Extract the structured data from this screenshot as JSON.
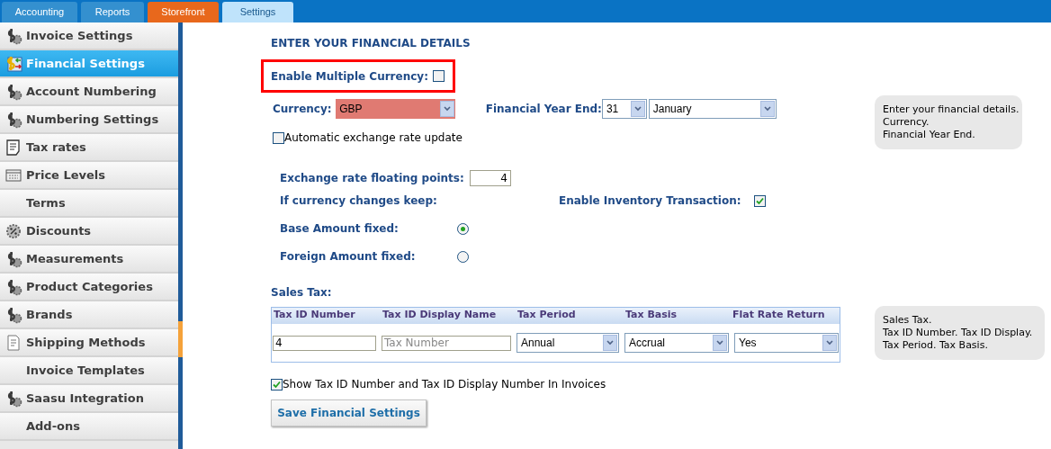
{
  "tabs": [
    {
      "label": "Accounting",
      "selected": false,
      "kind": "normal"
    },
    {
      "label": "Reports",
      "selected": false,
      "kind": "normal"
    },
    {
      "label": "Storefront",
      "selected": false,
      "kind": "highlight"
    },
    {
      "label": "Settings",
      "selected": true,
      "kind": "normal"
    }
  ],
  "sidebar": {
    "items": [
      {
        "label": "Invoice Settings",
        "selected": false,
        "kind": "gear"
      },
      {
        "label": "Financial Settings",
        "selected": true,
        "kind": "exchange"
      },
      {
        "label": "Account Numbering",
        "selected": false,
        "kind": "gear"
      },
      {
        "label": "Numbering Settings",
        "selected": false,
        "kind": "gear"
      },
      {
        "label": "Tax rates",
        "selected": false,
        "kind": "list"
      },
      {
        "label": "Price Levels",
        "selected": false,
        "kind": "price"
      },
      {
        "label": "Terms",
        "selected": false,
        "kind": "plain"
      },
      {
        "label": "Discounts",
        "selected": false,
        "kind": "percent"
      },
      {
        "label": "Measurements",
        "selected": false,
        "kind": "gear"
      },
      {
        "label": "Product Categories",
        "selected": false,
        "kind": "gear"
      },
      {
        "label": "Brands",
        "selected": false,
        "kind": "gear"
      },
      {
        "label": "Shipping Methods",
        "selected": false,
        "kind": "doc"
      },
      {
        "label": "Invoice Templates",
        "selected": false,
        "kind": "plain"
      },
      {
        "label": "Saasu Integration",
        "selected": false,
        "kind": "gear"
      },
      {
        "label": "Add-ons",
        "selected": false,
        "kind": "plain"
      }
    ]
  },
  "form": {
    "heading": "ENTER YOUR FINANCIAL DETAILS",
    "multiple_currency": {
      "label": "Enable Multiple Currency:",
      "checked": false
    },
    "currency": {
      "label": "Currency:",
      "value": "GBP"
    },
    "year_end": {
      "label": "Financial Year End:",
      "day": "31",
      "month": "January"
    },
    "auto_update": {
      "label": "Automatic exchange rate update",
      "checked": false
    },
    "floating_points": {
      "label": "Exchange rate floating points:",
      "value": "4"
    },
    "keep_label": "If currency changes keep:",
    "inventory": {
      "label": "Enable Inventory Transaction:",
      "checked": true
    },
    "radios": [
      {
        "label": "Base Amount fixed:",
        "selected": true
      },
      {
        "label": "Foreign Amount fixed:",
        "selected": false
      }
    ],
    "sales_tax": {
      "label": "Sales Tax:",
      "columns": [
        "Tax ID Number",
        "Tax ID Display Name",
        "Tax Period",
        "Tax Basis",
        "Flat Rate Return"
      ],
      "tax_id": "4",
      "display_name_placeholder": "Tax Number",
      "period": "Annual",
      "basis": "Accrual",
      "flat_rate": "Yes"
    },
    "show_tax_id": {
      "label": "Show Tax ID Number and Tax ID Display Number In Invoices",
      "checked": true
    },
    "save_button": "Save Financial Settings"
  },
  "notes": [
    [
      "Enter your financial details.",
      "Currency.",
      "Financial Year End."
    ],
    [
      "Sales Tax.",
      "Tax ID Number. Tax ID Display.",
      "Tax Period. Tax Basis."
    ]
  ]
}
